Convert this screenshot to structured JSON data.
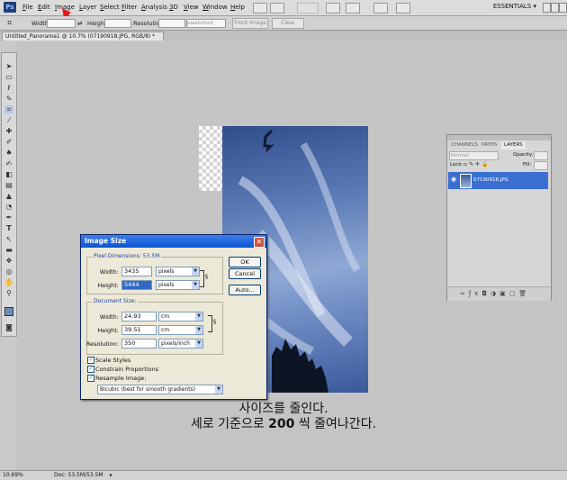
{
  "menubar": {
    "logo": "Ps",
    "items": [
      "File",
      "Edit",
      "Image",
      "Layer",
      "Select",
      "Filter",
      "Analysis",
      "3D",
      "View",
      "Window",
      "Help"
    ],
    "workspace": "ESSENTIALS ▾"
  },
  "options_bar": {
    "width_label": "Width:",
    "height_label": "Height:",
    "resolution_label": "Resolution:",
    "resolution_unit": "pixels/inch",
    "front_image_label": "Front Image",
    "clear_label": "Clear"
  },
  "document_tab": {
    "title": "Untitled_Panorama1 @ 10.7% (07190918.JPG, RGB/8) *"
  },
  "layers_panel": {
    "tabs": [
      "CHANNELS",
      "PATHS",
      "LAYERS"
    ],
    "active_tab": "LAYERS",
    "blend_mode": "Normal",
    "opacity_label": "Opacity:",
    "lock_label": "Lock:",
    "fill_label": "Fill:",
    "layer_name": "07190918.JPG"
  },
  "image_size_dialog": {
    "title": "Image Size",
    "pixel_dimensions_label": "Pixel Dimensions: 53.5M",
    "width_label": "Width:",
    "width_value": "3435",
    "width_unit": "pixels",
    "height_label": "Height:",
    "height_value": "5444",
    "height_unit": "pixels",
    "document_size_label": "Document Size:",
    "doc_width_label": "Width:",
    "doc_width_value": "24.93",
    "doc_width_unit": "cm",
    "doc_height_label": "Height:",
    "doc_height_value": "39.51",
    "doc_height_unit": "cm",
    "resolution_label": "Resolution:",
    "resolution_value": "350",
    "resolution_unit": "pixels/inch",
    "scale_styles_label": "Scale Styles",
    "constrain_label": "Constrain Proportions",
    "resample_label": "Resample Image:",
    "resample_method": "Bicubic (best for smooth gradients)",
    "ok_label": "OK",
    "cancel_label": "Cancel",
    "auto_label": "Auto..."
  },
  "caption": {
    "line1": "사이즈를 줄인다.",
    "line2_pre": "세로 기준으로 ",
    "line2_bold": "200",
    "line2_post": " 씩 줄여나간다."
  },
  "status_bar": {
    "zoom": "10.69%",
    "doc_size": "Doc: 53.5M/53.5M"
  },
  "colors": {
    "accent": "#3a6fd0",
    "annotation_arrow": "#e21b1b",
    "dialog_title": "#0a52d4"
  }
}
